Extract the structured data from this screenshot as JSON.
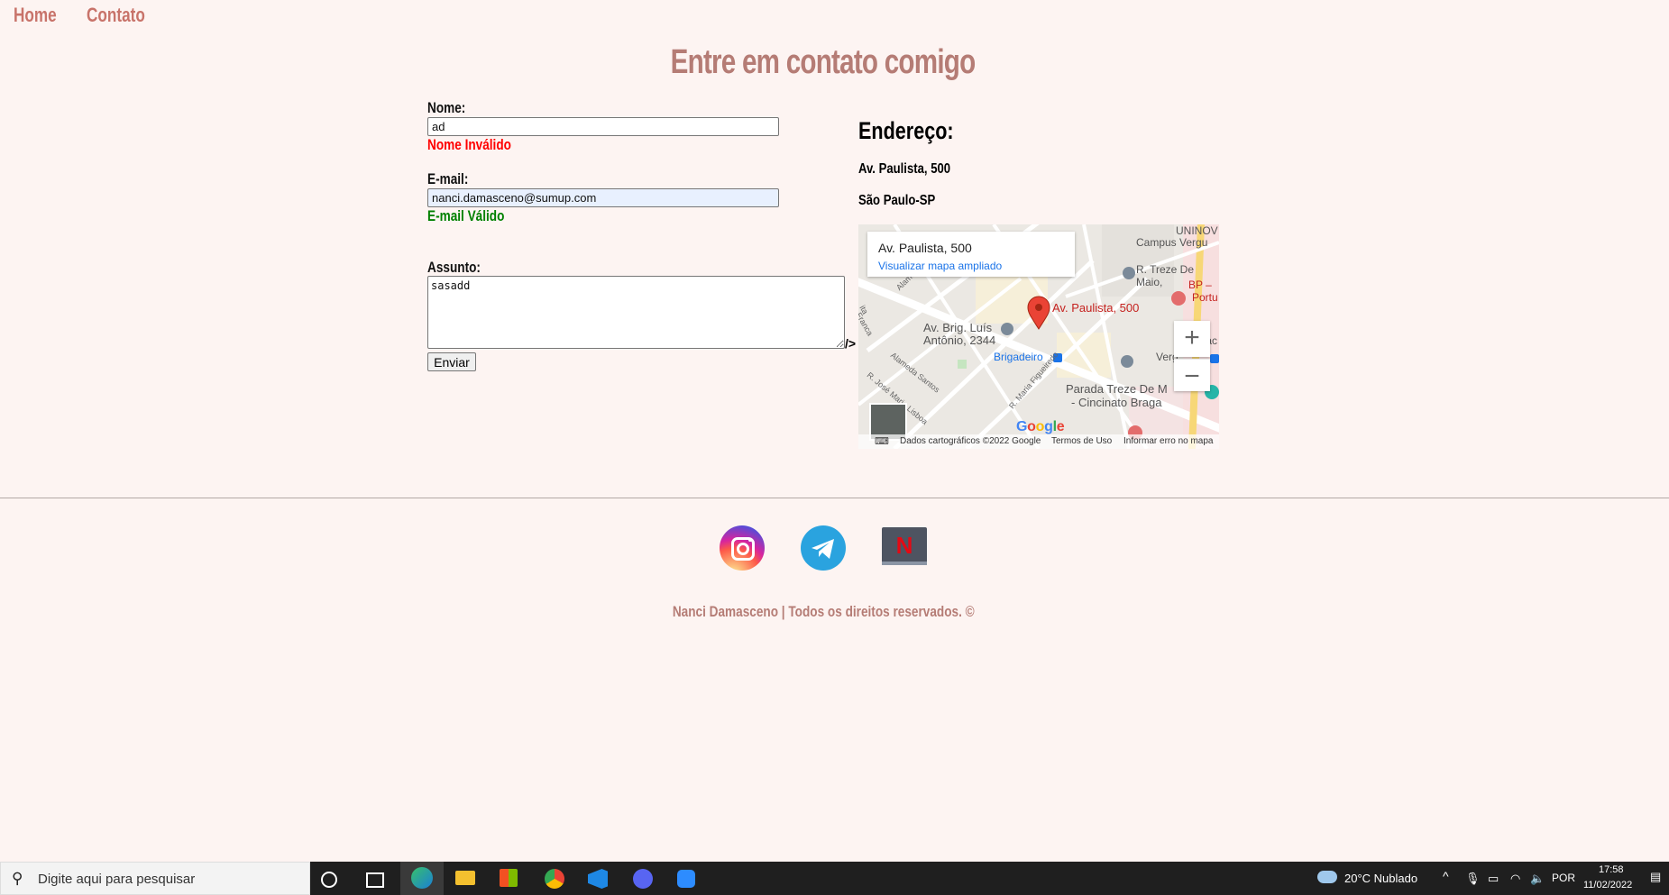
{
  "nav": {
    "home": "Home",
    "contact": "Contato"
  },
  "page_title": "Entre em contato comigo",
  "form": {
    "name_label": "Nome:",
    "name_value": "ad",
    "name_message": "Nome Inválido",
    "email_label": "E-mail:",
    "email_value": "nanci.damasceno@sumup.com",
    "email_message": "E-mail Válido",
    "subject_label": "Assunto:",
    "subject_value": "sasadd",
    "stray_text": "/>",
    "send_label": "Enviar"
  },
  "address": {
    "title": "Endereço:",
    "line1": "Av. Paulista, 500",
    "line2": "São Paulo-SP"
  },
  "map": {
    "card_title": "Av. Paulista, 500",
    "card_link": "Visualizar mapa ampliado",
    "labels": {
      "uninove": "UNINOV",
      "campus": "Campus Vergu",
      "treze": "R. Treze De Maio,",
      "bp": "BP –",
      "portu": "Portu",
      "brig": "Av. Brig. Luís",
      "antonio": "Antônio, 2344",
      "pin": "Av. Paulista, 500",
      "senac": "Senac",
      "brigadeiro": "Brigadeiro",
      "vergu": "Verg",
      "parada": "Parada Treze De M",
      "cincinato": "- Cincinato Braga",
      "alameda_campinas": "Alameda Campinas",
      "alameda_santos": "Alameda Santos",
      "maria_figueiredo": "R. Maria Figueiredo",
      "jose_maria": "R. José Maria Lisboa",
      "franca": "Franca",
      "ita": "ita"
    },
    "zoom_in": "+",
    "zoom_out": "−",
    "google": "Google",
    "footer": {
      "data": "Dados cartográficos ©2022 Google",
      "terms": "Termos de Uso",
      "report": "Informar erro no mapa"
    }
  },
  "footer": {
    "text": "Nanci Damasceno | Todos os direitos reservados. ©"
  },
  "social": {
    "instagram_icon": "instagram-icon",
    "telegram_icon": "telegram-icon",
    "netflix_icon": "netflix-icon",
    "netflix_letter": "N"
  },
  "taskbar": {
    "search_placeholder": "Digite aqui para pesquisar",
    "weather": "20°C  Nublado",
    "language": "POR",
    "time": "17:58",
    "date": "11/02/2022"
  },
  "colors": {
    "background": "#fdf4f2",
    "accent": "#c8736a",
    "title": "#b57c75",
    "invalid": "#ff0000",
    "valid": "#008000"
  }
}
